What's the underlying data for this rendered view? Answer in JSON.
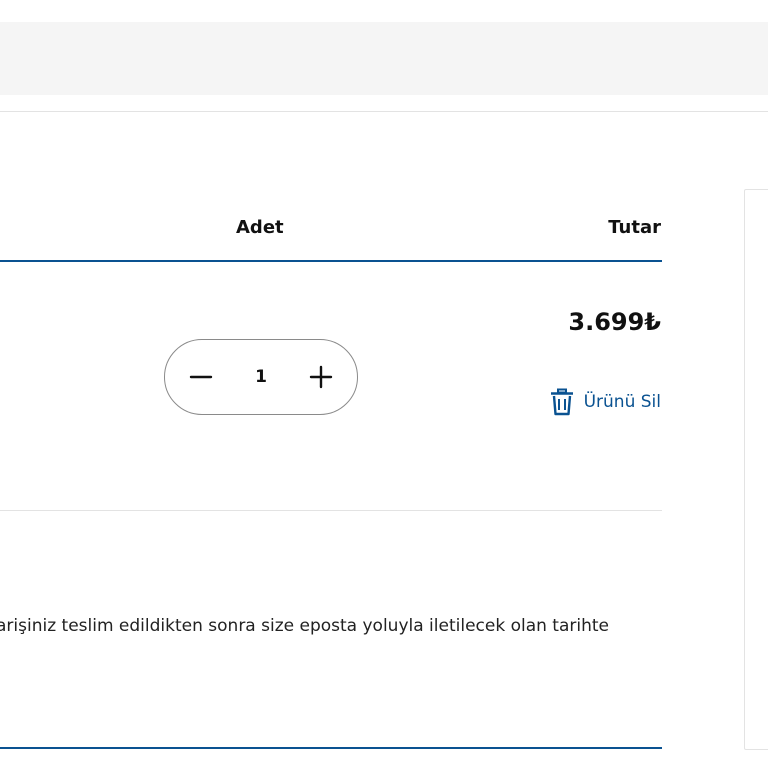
{
  "cart": {
    "headers": {
      "quantity": "Adet",
      "amount": "Tutar"
    },
    "item": {
      "price": "3.699₺",
      "quantity": "1",
      "remove_label": "Ürünü Sil"
    },
    "note": "arişiniz teslim edildikten sonra size eposta yoluyla iletilecek olan tarihte"
  },
  "icons": {
    "decrease": "minus-icon",
    "increase": "plus-icon",
    "remove": "trash-icon"
  },
  "colors": {
    "accent": "#0a5291",
    "text": "#111111",
    "top_bar": "#f5f5f5",
    "divider": "#e3e3e3"
  }
}
